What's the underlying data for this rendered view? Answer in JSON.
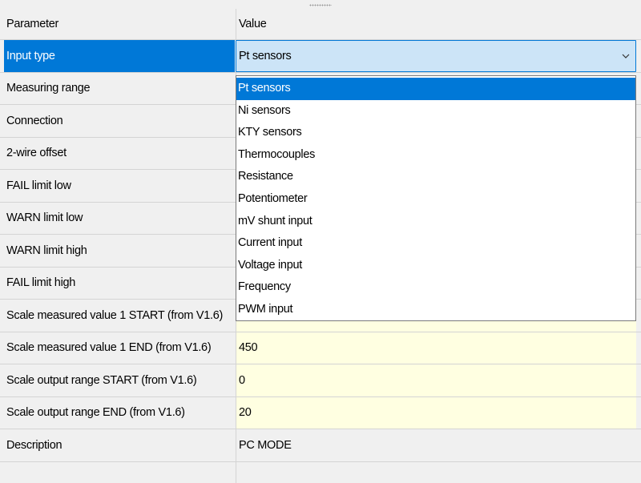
{
  "header": {
    "parameter": "Parameter",
    "value": "Value"
  },
  "rows": [
    {
      "label": "Input type",
      "value": "Pt sensors"
    },
    {
      "label": "Measuring range",
      "value": ""
    },
    {
      "label": "Connection",
      "value": ""
    },
    {
      "label": "2-wire offset",
      "value": ""
    },
    {
      "label": "FAIL limit low",
      "value": ""
    },
    {
      "label": "WARN limit low",
      "value": ""
    },
    {
      "label": "WARN limit high",
      "value": ""
    },
    {
      "label": "FAIL limit high",
      "value": ""
    },
    {
      "label": "Scale measured value 1 START (from V1.6)",
      "value": ""
    },
    {
      "label": "Scale measured value 1 END (from V1.6)",
      "value": "450"
    },
    {
      "label": "Scale output range START (from V1.6)",
      "value": "0"
    },
    {
      "label": "Scale output range END (from V1.6)",
      "value": "20"
    },
    {
      "label": "Description",
      "value": "PC MODE"
    }
  ],
  "dropdown": {
    "selected": "Pt sensors",
    "options": [
      "Pt sensors",
      "Ni sensors",
      "KTY sensors",
      "Thermocouples",
      "Resistance",
      "Potentiometer",
      "mV shunt input",
      "Current input",
      "Voltage input",
      "Frequency",
      "PWM input"
    ]
  },
  "icons": {
    "dropdown_arrow": "chevron-down-icon"
  },
  "colors": {
    "selection": "#0078d7",
    "combo_background": "#cce4f7",
    "editable_background": "#ffffe1",
    "grid_background": "#f0f0f0"
  }
}
